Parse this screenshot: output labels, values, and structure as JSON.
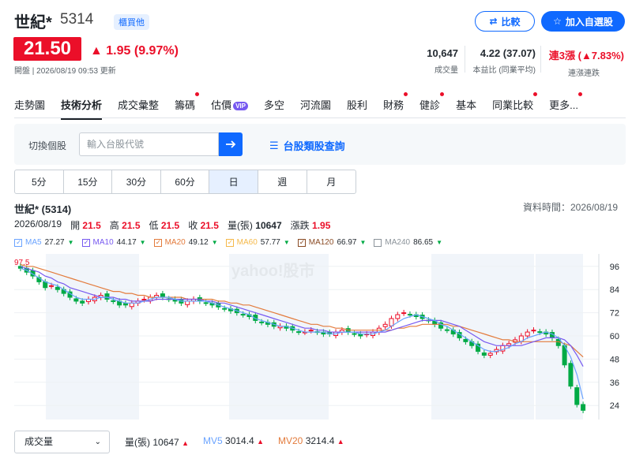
{
  "header": {
    "name": "世紀*",
    "code": "5314",
    "market": "櫃買他",
    "price": "21.50",
    "change": "▲ 1.95 (9.97%)",
    "update": "開盤 | 2026/08/19 09:53 更新",
    "compare_label": "比較",
    "add_label": "加入自選股"
  },
  "stats": [
    {
      "value": "10,647",
      "label": "成交量"
    },
    {
      "value": "4.22 (37.07)",
      "label": "本益比 (同業平均)"
    },
    {
      "value_prefix": "連3漲",
      "value": "(▲7.83%)",
      "label": "連漲連跌"
    }
  ],
  "tabs": [
    {
      "label": "走勢圖",
      "dot": false
    },
    {
      "label": "技術分析",
      "dot": false,
      "active": true
    },
    {
      "label": "成交彙整",
      "dot": false
    },
    {
      "label": "籌碼",
      "dot": true
    },
    {
      "label": "估價",
      "dot": false,
      "vip": "VIP"
    },
    {
      "label": "多空",
      "dot": false
    },
    {
      "label": "河流圖",
      "dot": false
    },
    {
      "label": "股利",
      "dot": false
    },
    {
      "label": "財務",
      "dot": true
    },
    {
      "label": "健診",
      "dot": true
    },
    {
      "label": "基本",
      "dot": false
    },
    {
      "label": "同業比較",
      "dot": true
    },
    {
      "label": "更多...",
      "dot": true
    }
  ],
  "search": {
    "label": "切換個股",
    "placeholder": "輸入台股代號",
    "category_link": "台股類股查詢"
  },
  "periods": [
    "5分",
    "15分",
    "30分",
    "60分",
    "日",
    "週",
    "月"
  ],
  "active_period": "日",
  "chart_header": {
    "title": "世紀* (5314)",
    "data_time": "資料時間：2026/08/19",
    "date": "2026/08/19",
    "open_label": "開",
    "open": "21.5",
    "high_label": "高",
    "high": "21.5",
    "low_label": "低",
    "low": "21.5",
    "close_label": "收",
    "close": "21.5",
    "volume_label": "量(張)",
    "volume": "10647",
    "change_label": "漲跌",
    "change": "1.95"
  },
  "ma": [
    {
      "label": "MA5",
      "value": "27.27",
      "color": "#6aa3ff"
    },
    {
      "label": "MA10",
      "value": "44.17",
      "color": "#7759f0"
    },
    {
      "label": "MA20",
      "value": "49.12",
      "color": "#e37b3c"
    },
    {
      "label": "MA60",
      "value": "57.77",
      "color": "#f5b94a"
    },
    {
      "label": "MA120",
      "value": "66.97",
      "color": "#8a4b24"
    },
    {
      "label": "MA240",
      "value": "86.65",
      "color": "#8b939a"
    }
  ],
  "watermark": "yahoo!股市",
  "chart_data": {
    "type": "candlestick",
    "y_ticks": [
      "96",
      "84",
      "72",
      "60",
      "48",
      "36",
      "24"
    ],
    "high_marker": "97.5",
    "ylim": [
      20,
      100
    ],
    "close": [
      95,
      93,
      91,
      88,
      85,
      86,
      84,
      82,
      80,
      78,
      77,
      79,
      80,
      81,
      79,
      78,
      76,
      76,
      77,
      78,
      79,
      80,
      81,
      80,
      79,
      78,
      77,
      78,
      79,
      78,
      77,
      76,
      75,
      74,
      73,
      72,
      71,
      70,
      68,
      67,
      66,
      65,
      65,
      64,
      63,
      62,
      62,
      63,
      62,
      61,
      61,
      62,
      63,
      62,
      61,
      60,
      61,
      62,
      64,
      66,
      69,
      71,
      72,
      71,
      70,
      69,
      68,
      66,
      64,
      63,
      61,
      59,
      57,
      55,
      52,
      50,
      51,
      53,
      55,
      56,
      58,
      60,
      62,
      63,
      62,
      61,
      59,
      55,
      45,
      34,
      24.5,
      21.5
    ],
    "ma5": [
      95,
      94,
      92,
      90,
      88,
      87,
      86,
      84,
      82,
      80,
      79,
      79,
      79,
      80,
      80,
      79,
      78,
      77,
      77,
      77,
      78,
      79,
      80,
      80,
      80,
      79,
      78,
      78,
      78,
      78,
      78,
      77,
      76,
      75,
      74,
      73,
      72,
      71,
      69,
      68,
      67,
      66,
      65,
      65,
      64,
      63,
      62,
      62,
      62,
      62,
      61,
      61,
      62,
      62,
      62,
      61,
      61,
      61,
      62,
      63,
      65,
      67,
      69,
      70,
      71,
      70,
      69,
      68,
      66,
      65,
      63,
      61,
      59,
      57,
      55,
      53,
      52,
      52,
      53,
      54,
      56,
      57,
      59,
      60,
      61,
      62,
      61,
      59,
      55,
      49,
      40,
      27.3
    ],
    "ma10": [
      96,
      95,
      94,
      93,
      91,
      90,
      88,
      87,
      85,
      84,
      83,
      82,
      81,
      80,
      80,
      80,
      79,
      79,
      78,
      78,
      78,
      78,
      79,
      79,
      79,
      79,
      79,
      79,
      79,
      79,
      78,
      78,
      77,
      77,
      76,
      75,
      74,
      73,
      72,
      71,
      70,
      69,
      68,
      67,
      66,
      65,
      64,
      64,
      63,
      63,
      62,
      62,
      62,
      62,
      62,
      62,
      62,
      62,
      62,
      62,
      63,
      64,
      65,
      66,
      67,
      68,
      68,
      68,
      68,
      67,
      66,
      65,
      63,
      61,
      59,
      57,
      56,
      55,
      55,
      55,
      55,
      55,
      56,
      57,
      58,
      59,
      59,
      59,
      58,
      55,
      50,
      44.2
    ],
    "ma20": [
      97,
      96,
      96,
      95,
      94,
      93,
      92,
      91,
      90,
      89,
      88,
      87,
      86,
      85,
      84,
      83,
      83,
      82,
      82,
      81,
      81,
      80,
      80,
      80,
      80,
      80,
      80,
      79,
      79,
      79,
      79,
      79,
      78,
      78,
      77,
      77,
      76,
      76,
      75,
      74,
      73,
      72,
      71,
      70,
      69,
      68,
      67,
      66,
      66,
      65,
      65,
      64,
      64,
      63,
      63,
      63,
      63,
      63,
      63,
      63,
      63,
      64,
      64,
      65,
      65,
      66,
      66,
      66,
      66,
      66,
      65,
      65,
      64,
      63,
      62,
      61,
      60,
      59,
      58,
      58,
      57,
      57,
      57,
      57,
      57,
      57,
      57,
      57,
      56,
      55,
      52,
      49.1
    ]
  },
  "bottom": {
    "select_label": "成交量",
    "vol_label": "量(張)",
    "vol": "10647",
    "mv5_label": "MV5",
    "mv5": "3014.4",
    "mv20_label": "MV20",
    "mv20": "3214.4"
  }
}
